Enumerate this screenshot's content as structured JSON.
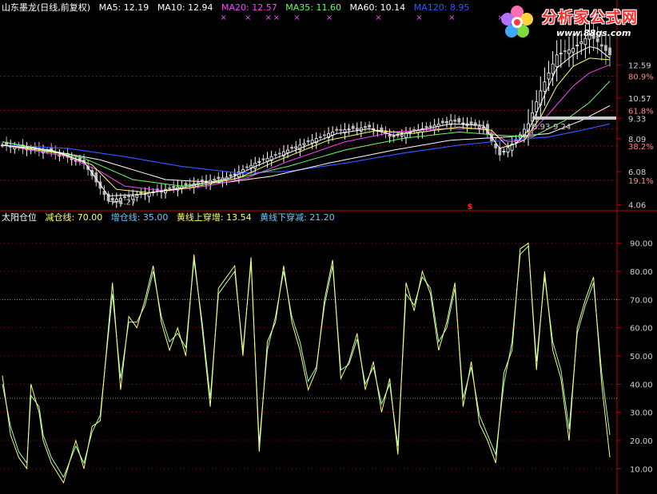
{
  "header_top": {
    "title": "山东墨龙(日线,前复权)",
    "ma": [
      {
        "label": "MA5: 12.19",
        "color": "#ffffff"
      },
      {
        "label": "MA10: 12.94",
        "color": "#ffffff"
      },
      {
        "label": "MA20: 12.57",
        "color": "#ff44ff"
      },
      {
        "label": "MA35: 11.60",
        "color": "#66ff66"
      },
      {
        "label": "MA60: 10.14",
        "color": "#ffffff"
      },
      {
        "label": "MA120: 8.95",
        "color": "#3355ff"
      }
    ]
  },
  "header_bottom": {
    "title": "太阳仓位",
    "items": [
      {
        "label": "减仓线: 70.00",
        "color": "#ffff66"
      },
      {
        "label": "增仓线: 35.00",
        "color": "#66ccff"
      },
      {
        "label": "黄线上穿增: 13.54",
        "color": "#ffff66"
      },
      {
        "label": "黄线下穿减: 21.20",
        "color": "#66ccff"
      }
    ]
  },
  "logo": {
    "brand": "分析家公式网",
    "url": "www.88gs.com"
  },
  "colors": {
    "background": "#000000",
    "axis": "#c00000",
    "grid": "#a00000",
    "label": "#d0d0d0",
    "up": "#ffffff",
    "ma5": "#ffffff",
    "ma10": "#ffff66",
    "ma20": "#ff44ff",
    "ma35": "#66ff66",
    "ma60": "#ffffff",
    "ma120": "#3355ff",
    "yellow_line": "#ffff66",
    "cyan_line": "#99ffcc",
    "marker": "#ff44ff"
  },
  "chart_data": [
    {
      "type": "candlestick",
      "title": "山东墨龙(日线,前复权)",
      "n_bars": 150,
      "ylim": [
        3.8,
        14.6
      ],
      "y_ticks": [
        {
          "value": 12.59,
          "label": "12.59"
        },
        {
          "value": 10.57,
          "label": "10.57"
        },
        {
          "value": 9.33,
          "label": "9.33"
        },
        {
          "value": 8.09,
          "label": "8.09"
        },
        {
          "value": 6.08,
          "label": "6.08"
        },
        {
          "value": 4.06,
          "label": "4.06"
        }
      ],
      "pct_ticks": [
        {
          "value": 11.9,
          "label": "80.9%"
        },
        {
          "value": 9.8,
          "label": "61.8%"
        },
        {
          "value": 7.65,
          "label": "38.2%"
        },
        {
          "value": 5.55,
          "label": "19.1%"
        }
      ],
      "dotted_levels": [
        11.9,
        9.8,
        8.7,
        7.65,
        5.55
      ],
      "close_anchors": [
        [
          0,
          7.7
        ],
        [
          12,
          7.3
        ],
        [
          20,
          6.6
        ],
        [
          26,
          4.3
        ],
        [
          34,
          4.7
        ],
        [
          44,
          5.2
        ],
        [
          56,
          5.8
        ],
        [
          62,
          6.6
        ],
        [
          68,
          7.2
        ],
        [
          82,
          8.6
        ],
        [
          90,
          8.8
        ],
        [
          96,
          8.2
        ],
        [
          110,
          9.2
        ],
        [
          118,
          8.8
        ],
        [
          122,
          7.1
        ],
        [
          126,
          8.0
        ],
        [
          129,
          9.0
        ],
        [
          132,
          11.0
        ],
        [
          136,
          13.2
        ],
        [
          140,
          13.6
        ],
        [
          144,
          14.4
        ],
        [
          146,
          14.0
        ],
        [
          149,
          13.2
        ]
      ],
      "ma5": [
        [
          0,
          7.7
        ],
        [
          12,
          7.4
        ],
        [
          20,
          6.7
        ],
        [
          26,
          4.6
        ],
        [
          34,
          4.7
        ],
        [
          44,
          5.1
        ],
        [
          56,
          5.7
        ],
        [
          62,
          6.4
        ],
        [
          68,
          7.0
        ],
        [
          82,
          8.4
        ],
        [
          90,
          8.7
        ],
        [
          96,
          8.3
        ],
        [
          110,
          9.0
        ],
        [
          118,
          8.9
        ],
        [
          122,
          7.5
        ],
        [
          126,
          7.8
        ],
        [
          129,
          8.6
        ],
        [
          132,
          10.2
        ],
        [
          136,
          12.4
        ],
        [
          140,
          13.2
        ],
        [
          144,
          13.7
        ],
        [
          146,
          13.6
        ],
        [
          149,
          13.0
        ]
      ],
      "ma10": [
        [
          0,
          7.7
        ],
        [
          14,
          7.2
        ],
        [
          22,
          6.5
        ],
        [
          28,
          5.0
        ],
        [
          36,
          4.8
        ],
        [
          46,
          5.1
        ],
        [
          58,
          5.7
        ],
        [
          66,
          6.6
        ],
        [
          80,
          8.0
        ],
        [
          92,
          8.6
        ],
        [
          100,
          8.4
        ],
        [
          112,
          8.8
        ],
        [
          120,
          8.6
        ],
        [
          124,
          7.6
        ],
        [
          128,
          8.0
        ],
        [
          132,
          9.4
        ],
        [
          136,
          11.3
        ],
        [
          140,
          12.5
        ],
        [
          144,
          13.0
        ],
        [
          149,
          12.9
        ]
      ],
      "ma20": [
        [
          0,
          7.7
        ],
        [
          16,
          7.0
        ],
        [
          24,
          6.1
        ],
        [
          30,
          5.2
        ],
        [
          40,
          4.9
        ],
        [
          50,
          5.2
        ],
        [
          60,
          5.7
        ],
        [
          70,
          6.7
        ],
        [
          84,
          7.9
        ],
        [
          96,
          8.5
        ],
        [
          108,
          8.7
        ],
        [
          118,
          8.7
        ],
        [
          124,
          7.9
        ],
        [
          128,
          8.0
        ],
        [
          134,
          9.6
        ],
        [
          140,
          11.3
        ],
        [
          144,
          12.1
        ],
        [
          149,
          12.6
        ]
      ],
      "ma35": [
        [
          0,
          7.9
        ],
        [
          20,
          6.9
        ],
        [
          32,
          5.6
        ],
        [
          44,
          5.2
        ],
        [
          56,
          5.6
        ],
        [
          70,
          6.4
        ],
        [
          84,
          7.4
        ],
        [
          98,
          8.1
        ],
        [
          112,
          8.5
        ],
        [
          122,
          8.3
        ],
        [
          130,
          8.2
        ],
        [
          138,
          9.2
        ],
        [
          144,
          10.3
        ],
        [
          149,
          11.6
        ]
      ],
      "ma60": [
        [
          0,
          7.9
        ],
        [
          24,
          6.8
        ],
        [
          40,
          5.6
        ],
        [
          54,
          5.4
        ],
        [
          66,
          5.8
        ],
        [
          80,
          6.6
        ],
        [
          96,
          7.4
        ],
        [
          110,
          8.0
        ],
        [
          124,
          8.2
        ],
        [
          134,
          8.4
        ],
        [
          142,
          9.2
        ],
        [
          149,
          10.1
        ]
      ],
      "ma120": [
        [
          0,
          7.7
        ],
        [
          16,
          7.5
        ],
        [
          30,
          7.0
        ],
        [
          44,
          6.4
        ],
        [
          58,
          6.0
        ],
        [
          70,
          6.1
        ],
        [
          84,
          6.6
        ],
        [
          98,
          7.2
        ],
        [
          112,
          7.7
        ],
        [
          124,
          8.0
        ],
        [
          134,
          8.2
        ],
        [
          142,
          8.6
        ],
        [
          149,
          9.0
        ]
      ],
      "annotations": [
        {
          "bar": 26,
          "value": 4.27,
          "label": "4.27"
        },
        {
          "bar": 130,
          "value": 8.93,
          "label": "8.93-9.24"
        }
      ],
      "marker_bars": [
        54,
        60,
        65,
        67,
        72,
        80,
        92,
        102,
        110,
        122,
        140
      ]
    },
    {
      "type": "line",
      "title": "太阳仓位",
      "n_bars": 150,
      "ylim": [
        3,
        97
      ],
      "y_ticks": [
        {
          "value": 90,
          "label": "90.00"
        },
        {
          "value": 80,
          "label": "80.00"
        },
        {
          "value": 70,
          "label": "70.00"
        },
        {
          "value": 60,
          "label": "60.00"
        },
        {
          "value": 50,
          "label": "50.00"
        },
        {
          "value": 40,
          "label": "40.00"
        },
        {
          "value": 30,
          "label": "30.00"
        },
        {
          "value": 20,
          "label": "20.00"
        },
        {
          "value": 10,
          "label": "10.00"
        }
      ],
      "dotted_levels": [
        70,
        35
      ],
      "yellow": [
        [
          0,
          43
        ],
        [
          2,
          22
        ],
        [
          4,
          14
        ],
        [
          6,
          10
        ],
        [
          7,
          40
        ],
        [
          9,
          30
        ],
        [
          10,
          20
        ],
        [
          12,
          12
        ],
        [
          15,
          5
        ],
        [
          18,
          20
        ],
        [
          20,
          10
        ],
        [
          22,
          25
        ],
        [
          24,
          27
        ],
        [
          27,
          76
        ],
        [
          29,
          38
        ],
        [
          31,
          64
        ],
        [
          33,
          60
        ],
        [
          35,
          70
        ],
        [
          37,
          82
        ],
        [
          39,
          62
        ],
        [
          41,
          52
        ],
        [
          43,
          60
        ],
        [
          45,
          50
        ],
        [
          47,
          86
        ],
        [
          49,
          60
        ],
        [
          51,
          32
        ],
        [
          53,
          74
        ],
        [
          55,
          78
        ],
        [
          57,
          82
        ],
        [
          59,
          50
        ],
        [
          61,
          85
        ],
        [
          63,
          16
        ],
        [
          65,
          55
        ],
        [
          67,
          62
        ],
        [
          69,
          82
        ],
        [
          71,
          62
        ],
        [
          73,
          52
        ],
        [
          75,
          38
        ],
        [
          77,
          45
        ],
        [
          79,
          70
        ],
        [
          81,
          84
        ],
        [
          83,
          42
        ],
        [
          85,
          48
        ],
        [
          87,
          58
        ],
        [
          89,
          38
        ],
        [
          91,
          48
        ],
        [
          93,
          30
        ],
        [
          95,
          42
        ],
        [
          97,
          15
        ],
        [
          99,
          76
        ],
        [
          101,
          66
        ],
        [
          103,
          80
        ],
        [
          105,
          72
        ],
        [
          107,
          52
        ],
        [
          109,
          62
        ],
        [
          111,
          76
        ],
        [
          113,
          32
        ],
        [
          115,
          48
        ],
        [
          117,
          26
        ],
        [
          119,
          20
        ],
        [
          121,
          12
        ],
        [
          123,
          44
        ],
        [
          125,
          52
        ],
        [
          127,
          88
        ],
        [
          129,
          90
        ],
        [
          131,
          45
        ],
        [
          133,
          80
        ],
        [
          135,
          52
        ],
        [
          137,
          42
        ],
        [
          139,
          20
        ],
        [
          141,
          60
        ],
        [
          143,
          70
        ],
        [
          145,
          78
        ],
        [
          147,
          40
        ],
        [
          149,
          14
        ]
      ],
      "cyan": [
        [
          0,
          40
        ],
        [
          2,
          25
        ],
        [
          4,
          16
        ],
        [
          6,
          12
        ],
        [
          7,
          36
        ],
        [
          9,
          32
        ],
        [
          10,
          22
        ],
        [
          12,
          14
        ],
        [
          15,
          7
        ],
        [
          18,
          18
        ],
        [
          20,
          12
        ],
        [
          22,
          23
        ],
        [
          24,
          29
        ],
        [
          27,
          72
        ],
        [
          29,
          42
        ],
        [
          31,
          62
        ],
        [
          33,
          62
        ],
        [
          35,
          68
        ],
        [
          37,
          80
        ],
        [
          39,
          64
        ],
        [
          41,
          55
        ],
        [
          43,
          58
        ],
        [
          45,
          53
        ],
        [
          47,
          84
        ],
        [
          49,
          62
        ],
        [
          51,
          35
        ],
        [
          53,
          72
        ],
        [
          55,
          76
        ],
        [
          57,
          80
        ],
        [
          59,
          52
        ],
        [
          61,
          83
        ],
        [
          63,
          19
        ],
        [
          65,
          52
        ],
        [
          67,
          64
        ],
        [
          69,
          80
        ],
        [
          71,
          64
        ],
        [
          73,
          55
        ],
        [
          75,
          41
        ],
        [
          77,
          46
        ],
        [
          79,
          68
        ],
        [
          81,
          82
        ],
        [
          83,
          45
        ],
        [
          85,
          47
        ],
        [
          87,
          56
        ],
        [
          89,
          40
        ],
        [
          91,
          46
        ],
        [
          93,
          33
        ],
        [
          95,
          40
        ],
        [
          97,
          18
        ],
        [
          99,
          72
        ],
        [
          101,
          68
        ],
        [
          103,
          78
        ],
        [
          105,
          74
        ],
        [
          107,
          55
        ],
        [
          109,
          60
        ],
        [
          111,
          74
        ],
        [
          113,
          35
        ],
        [
          115,
          46
        ],
        [
          117,
          29
        ],
        [
          119,
          22
        ],
        [
          121,
          15
        ],
        [
          123,
          40
        ],
        [
          125,
          55
        ],
        [
          127,
          86
        ],
        [
          129,
          89
        ],
        [
          131,
          48
        ],
        [
          133,
          78
        ],
        [
          135,
          55
        ],
        [
          137,
          45
        ],
        [
          139,
          24
        ],
        [
          141,
          58
        ],
        [
          143,
          68
        ],
        [
          145,
          76
        ],
        [
          147,
          44
        ],
        [
          149,
          22
        ]
      ]
    }
  ]
}
